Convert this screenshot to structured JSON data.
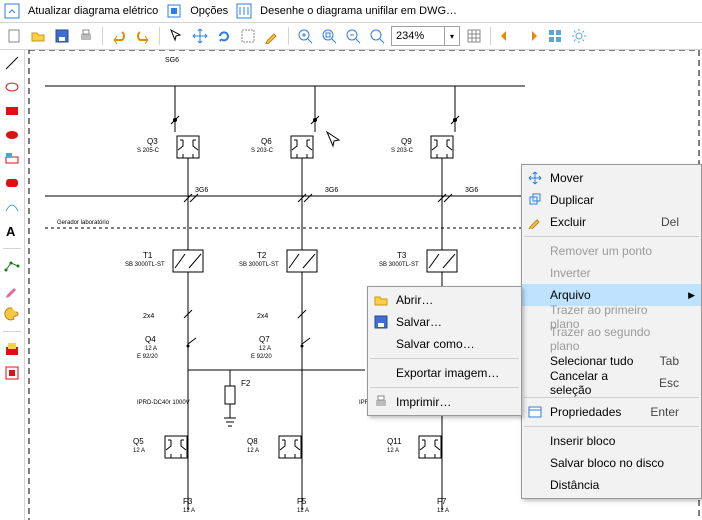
{
  "menubar": {
    "update": "Atualizar diagrama elétrico",
    "options": "Opções",
    "draw": "Desenhe o diagrama unifilar em DWG…"
  },
  "toolbar": {
    "zoom_value": "234%"
  },
  "diagram": {
    "top": {
      "sg6": "SG6"
    },
    "row1": {
      "q3": "Q3",
      "q3b": "S 205-C",
      "q6": "Q6",
      "q6b": "S 203-C",
      "q9": "Q9",
      "q9b": "S 203-C"
    },
    "bus36": {
      "a": "3G6",
      "b": "3G6",
      "c": "3G6"
    },
    "gen": "Gerador laboratório",
    "trafo": {
      "t1": "T1",
      "t1b": "SB 3000TL-ST",
      "t2": "T2",
      "t2b": "SB 3000TL-ST",
      "t3": "T3",
      "t3b": "SB 3000TL-ST"
    },
    "bus24": {
      "a": "2x4",
      "b": "2x4"
    },
    "row3": {
      "q4": "Q4",
      "q4b": "12 A",
      "q4c": "E 92/20",
      "q7": "Q7",
      "q7b": "12 A",
      "q7c": "E 92/20"
    },
    "fuse": {
      "f2": "F2",
      "f2b": "IPRD-DC40r 1000V",
      "ip": "IPF"
    },
    "row4": {
      "q5": "Q5",
      "q5b": "12 A",
      "q8": "Q8",
      "q8b": "12 A",
      "q11": "Q11",
      "q11b": "12 A"
    },
    "row5": {
      "f3": "F3",
      "f3b": "12 A",
      "f5": "F5",
      "f5b": "12 A",
      "f7": "F7",
      "f7b": "12 A"
    }
  },
  "context": {
    "move": "Mover",
    "duplicate": "Duplicar",
    "delete": "Excluir",
    "delete_sc": "Del",
    "remove_point": "Remover um ponto",
    "invert": "Inverter",
    "file": "Arquivo",
    "bring_front": "Trazer ao primeiro plano",
    "send_back": "Trazer ao segundo plano",
    "select_all": "Selecionar tudo",
    "select_all_sc": "Tab",
    "cancel_sel": "Cancelar a seleção",
    "cancel_sel_sc": "Esc",
    "properties": "Propriedades",
    "properties_sc": "Enter",
    "insert_block": "Inserir bloco",
    "save_block": "Salvar bloco no disco",
    "distance": "Distância"
  },
  "submenu": {
    "open": "Abrir…",
    "save": "Salvar…",
    "save_as": "Salvar como…",
    "export_img": "Exportar imagem…",
    "print": "Imprimir…"
  }
}
